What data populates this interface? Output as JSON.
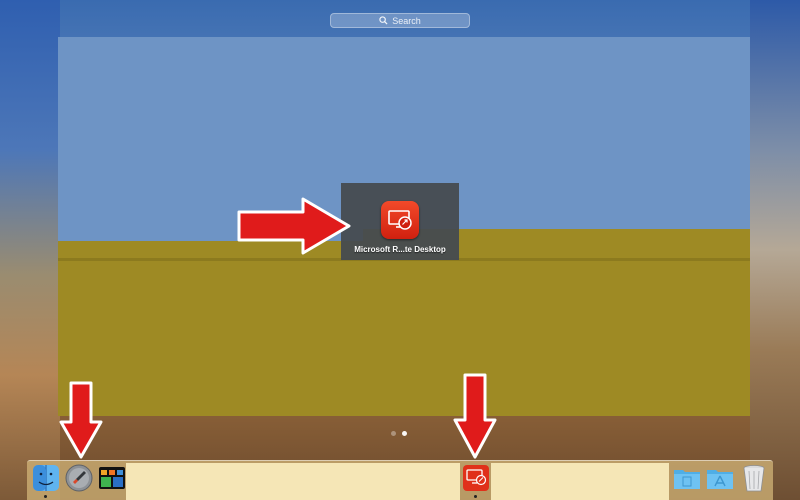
{
  "search": {
    "placeholder": "Search"
  },
  "launchpad": {
    "app_tile": {
      "label": "Microsoft R...te Desktop",
      "icon": "remote-desktop-icon"
    },
    "pages": {
      "count": 2,
      "active_index": 1
    }
  },
  "dock": {
    "items": [
      {
        "name": "Finder",
        "icon": "finder-icon",
        "running": true
      },
      {
        "name": "Launchpad",
        "icon": "rocket-icon",
        "running": false
      },
      {
        "name": "Mission Control",
        "icon": "mission-control-icon",
        "running": false
      },
      {
        "name": "Microsoft Remote Desktop",
        "icon": "remote-desktop-icon",
        "running": true
      },
      {
        "name": "Documents",
        "icon": "folder-icon",
        "running": false
      },
      {
        "name": "Applications",
        "icon": "app-store-folder-icon",
        "running": false
      },
      {
        "name": "Trash",
        "icon": "trash-icon",
        "running": false
      }
    ]
  },
  "colors": {
    "panel_blue": "#6e94c5",
    "panel_olive": "#9e8a24",
    "arrow_red": "#e01b1b",
    "app_red": "#e0301a",
    "dock_panel": "#f5e6b6"
  }
}
